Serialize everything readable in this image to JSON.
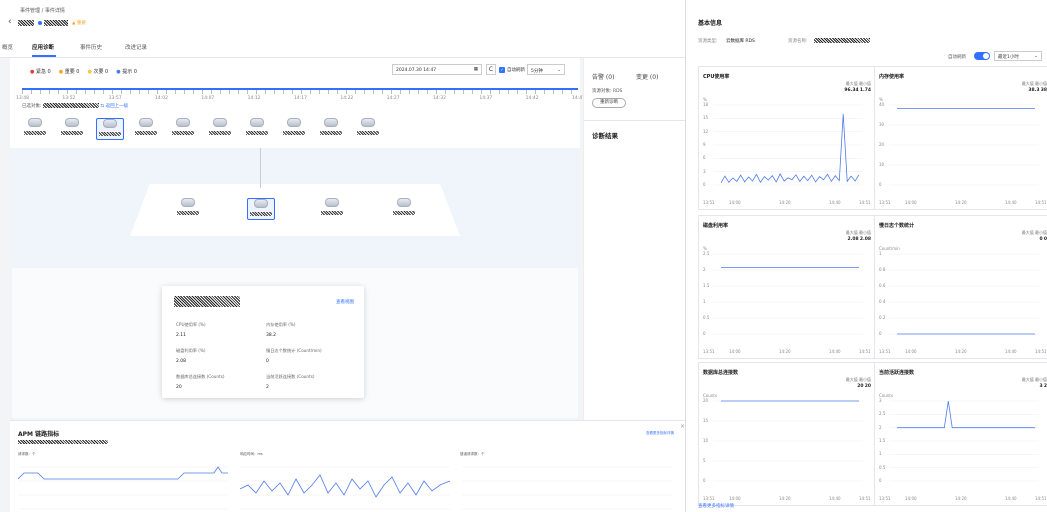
{
  "breadcrumb": {
    "parent": "事件管理",
    "sep": "/",
    "current": "事件详情"
  },
  "header": {
    "status": "▲ 重要"
  },
  "tabs": [
    {
      "label": "概览"
    },
    {
      "label": "应用诊断"
    },
    {
      "label": "事件历史"
    },
    {
      "label": "改进记录"
    }
  ],
  "legend": [
    {
      "label": "紧急 0",
      "color": "#e23b3b"
    },
    {
      "label": "重要 0",
      "color": "#f5a623"
    },
    {
      "label": "次要 0",
      "color": "#f2c94c"
    },
    {
      "label": "提示 0",
      "color": "#4e7bea"
    }
  ],
  "toolbar": {
    "datetime": "2024.07.30 14:47",
    "auto_refresh": "自动刷新",
    "interval": "5分钟"
  },
  "timeline": {
    "ticks": [
      "13:48",
      "13:52",
      "13:57",
      "14:02",
      "14:07",
      "14:12",
      "14:17",
      "14:22",
      "14:27",
      "14:32",
      "14:37",
      "14:42",
      "14:47"
    ],
    "selected_label": "已选对象:",
    "back_label": "返回上一级"
  },
  "diag": {
    "alarm": "告警 (0)",
    "change": "变更 (0)",
    "type_label": "资源对象: RDS",
    "diag_button": "重新诊断",
    "result_title": "诊断结果"
  },
  "popup": {
    "link": "查看视图",
    "metrics": [
      {
        "label": "CPU使用率 (%)",
        "value": "2.11"
      },
      {
        "label": "内存使用率 (%)",
        "value": "38.2"
      },
      {
        "label": "磁盘利用率 (%)",
        "value": "2.08"
      },
      {
        "label": "慢日志个数统计 (Count/min)",
        "value": "0"
      },
      {
        "label": "数据库总连接数 (Counts)",
        "value": "20"
      },
      {
        "label": "当前活跃连接数 (Counts)",
        "value": "2"
      }
    ]
  },
  "apm": {
    "title": "APM 链路指标",
    "link": "查看更多指标详情",
    "charts": [
      {
        "label": "请求数：个"
      },
      {
        "label": "响应时间：ms"
      },
      {
        "label": "错误请求数：个"
      }
    ]
  },
  "right": {
    "title": "基本信息",
    "type_label": "资源类型:",
    "type_value": "云数据库 RDS",
    "name_label": "资源名称:",
    "auto_refresh": "自动刷新",
    "range": "最近1小时",
    "more_link": "查看更多指标详情",
    "x_ticks": [
      "13:51",
      "14:00",
      "14:20",
      "14:40",
      "14:51"
    ],
    "cards": [
      {
        "title": "CPU使用率",
        "max_label": "最大值",
        "min_label": "最小值",
        "max": "96.34",
        "min": "1.74",
        "unit": "%",
        "yticks": [
          "18",
          "15",
          "12",
          "9",
          "6",
          "3",
          "0"
        ]
      },
      {
        "title": "内存使用率",
        "max_label": "最大值",
        "min_label": "最小值",
        "max": "38.3",
        "min": "38",
        "unit": "%",
        "yticks": [
          "40",
          "30",
          "20",
          "10",
          "0"
        ]
      },
      {
        "title": "磁盘利用率",
        "max_label": "最大值",
        "min_label": "最小值",
        "max": "2.08",
        "min": "2.08",
        "unit": "%",
        "yticks": [
          "2.5",
          "2",
          "1.5",
          "1",
          "0.5",
          "0"
        ]
      },
      {
        "title": "慢日志个数统计",
        "max_label": "最大值",
        "min_label": "最小值",
        "max": "0",
        "min": "0",
        "unit": "Count/min",
        "yticks": [
          "1",
          "0.8",
          "0.6",
          "0.4",
          "0.2",
          "0"
        ]
      },
      {
        "title": "数据库总连接数",
        "max_label": "最大值",
        "min_label": "最小值",
        "max": "20",
        "min": "20",
        "unit": "Counts",
        "yticks": [
          "20",
          "15",
          "10",
          "5",
          "0"
        ]
      },
      {
        "title": "当前活跃连接数",
        "max_label": "最大值",
        "min_label": "最小值",
        "max": "3",
        "min": "2",
        "unit": "Counts",
        "yticks": [
          "3",
          "2.5",
          "2",
          "1.5",
          "1",
          "0.5",
          "0"
        ]
      }
    ]
  },
  "colors": {
    "primary": "#3370ff",
    "line": "#4e7bea"
  }
}
